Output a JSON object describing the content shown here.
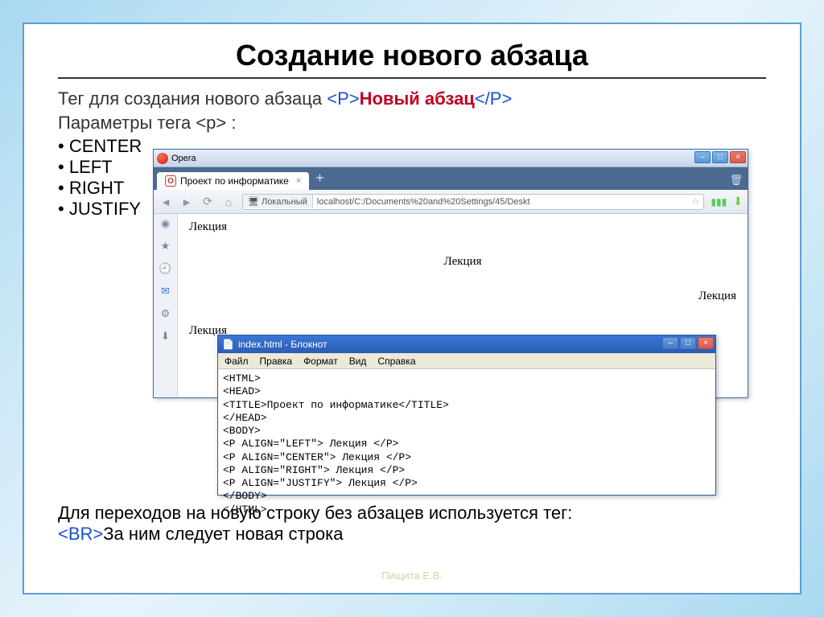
{
  "slide": {
    "title": "Создание нового абзаца",
    "intro_prefix": "Тег для создания нового абзаца ",
    "tag_open": "<Р>",
    "tag_text": "Новый абзац",
    "tag_close": "</Р>",
    "params_line": "Параметры тега <p> :",
    "params": [
      "CENTER",
      "LEFT",
      "RIGHT",
      "JUSTIFY"
    ],
    "outro_line1": "Для переходов на новую строку без абзацев используется тег:",
    "outro_br": "<BR>",
    "outro_tail": "За ним следует новая строка",
    "footer": "Пищита Е.В."
  },
  "browser": {
    "app_name": "Opera",
    "tab_label": "Проект по информатике",
    "url_local": "Локальный",
    "url_addr": "localhost/C:/Documents%20and%20Settings/45/Deskt",
    "page_text": "Лекция",
    "sidebar_icons": [
      "home",
      "star",
      "clock",
      "mail",
      "gear",
      "download"
    ]
  },
  "notepad": {
    "title": "index.html - Блокнот",
    "menu": [
      "Файл",
      "Правка",
      "Формат",
      "Вид",
      "Справка"
    ],
    "content": "<HTML>\n<HEAD>\n<TITLE>Проект по информатике</TITLE>\n</HEAD>\n<BODY>\n<P ALIGN=\"LEFT\"> Лекция </P>\n<P ALIGN=\"CENTER\"> Лекция </P>\n<P ALIGN=\"RIGHT\"> Лекция </P>\n<P ALIGN=\"JUSTIFY\"> Лекция </P>\n</BODY>\n</HTML>"
  }
}
